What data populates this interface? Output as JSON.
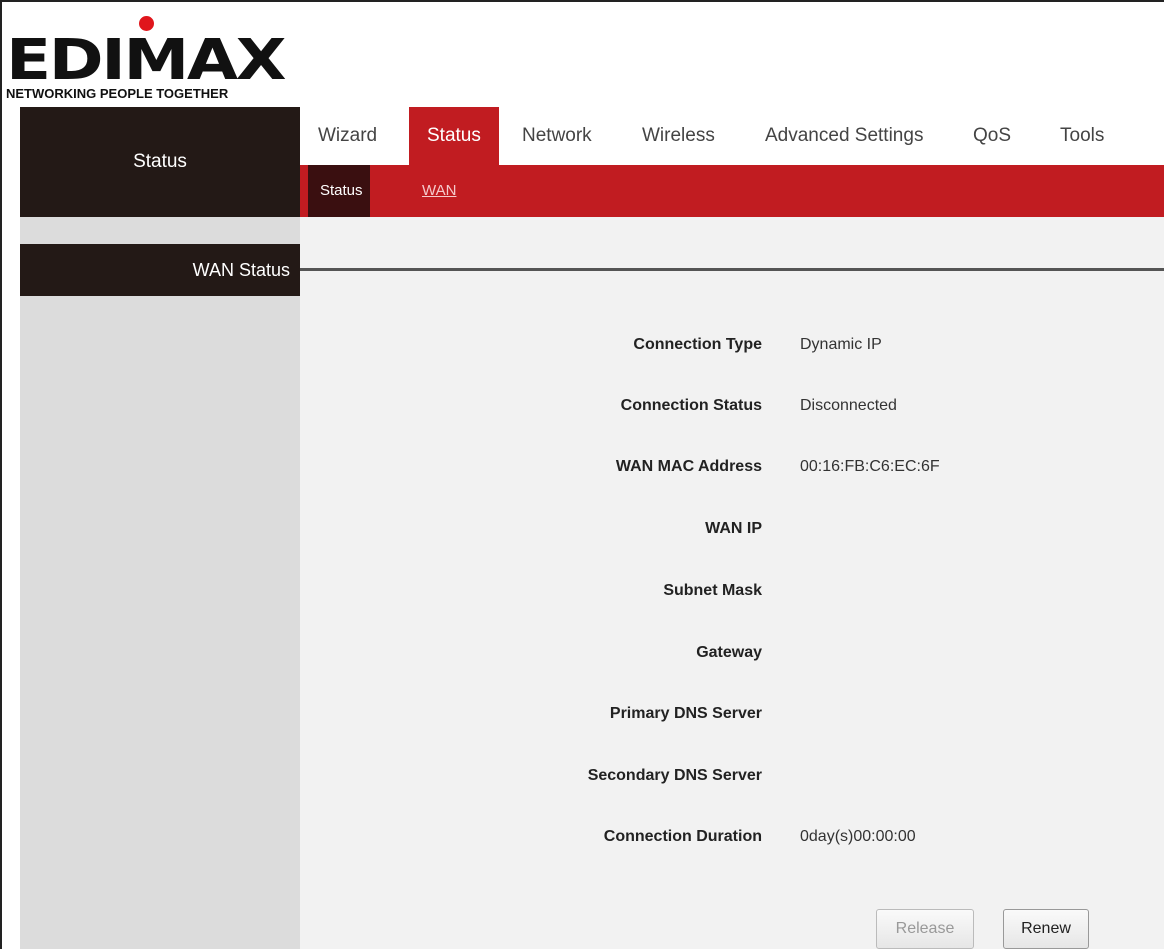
{
  "brand": {
    "logo_text": "EDIMAX",
    "tagline": "NETWORKING PEOPLE TOGETHER"
  },
  "sidebar": {
    "title": "Status",
    "section_title": "WAN Status"
  },
  "nav": {
    "tabs": [
      {
        "label": "Wizard",
        "active": false
      },
      {
        "label": "Status",
        "active": true
      },
      {
        "label": "Network",
        "active": false
      },
      {
        "label": "Wireless",
        "active": false
      },
      {
        "label": "Advanced Settings",
        "active": false
      },
      {
        "label": "QoS",
        "active": false
      },
      {
        "label": "Tools",
        "active": false
      }
    ]
  },
  "subnav": {
    "tabs": [
      {
        "label": "Status",
        "active": true
      },
      {
        "label": "WAN",
        "active": false
      }
    ]
  },
  "wan_status": {
    "rows": [
      {
        "label": "Connection Type",
        "value": "Dynamic IP"
      },
      {
        "label": "Connection Status",
        "value": "Disconnected"
      },
      {
        "label": "WAN MAC Address",
        "value": "00:16:FB:C6:EC:6F"
      },
      {
        "label": "WAN IP",
        "value": ""
      },
      {
        "label": "Subnet Mask",
        "value": ""
      },
      {
        "label": "Gateway",
        "value": ""
      },
      {
        "label": "Primary DNS Server",
        "value": ""
      },
      {
        "label": "Secondary DNS Server",
        "value": ""
      },
      {
        "label": "Connection Duration",
        "value": "0day(s)00:00:00"
      }
    ]
  },
  "buttons": {
    "release_label": "Release",
    "renew_label": "Renew"
  },
  "colors": {
    "accent_red": "#c11c21",
    "dark_panel": "#231916",
    "logo_dot": "#e0161c"
  }
}
